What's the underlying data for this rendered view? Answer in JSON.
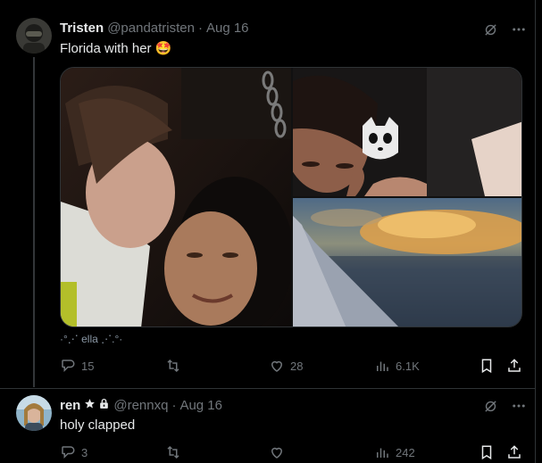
{
  "tweets": [
    {
      "display_name": "Tristen",
      "handle": "@pandatristen",
      "date": "Aug 16",
      "text": "Florida with her",
      "emoji": "🤩",
      "caption": "·°⋰ ella ⋰.°·",
      "stats": {
        "replies": "15",
        "retweets": "",
        "likes": "28",
        "views": "6.1K"
      }
    },
    {
      "display_name": "ren",
      "handle": "@rennxq",
      "date": "Aug 16",
      "text": "holy clapped",
      "stats": {
        "replies": "3",
        "retweets": "",
        "likes": "",
        "views": "242"
      }
    }
  ],
  "meta_sep": "·",
  "colors": {
    "bg": "#000000",
    "text": "#e7e9ea",
    "muted": "#71767b",
    "border": "#2f3336"
  },
  "icons": [
    "grok-icon",
    "more-icon",
    "reply-icon",
    "retweet-icon",
    "like-icon",
    "views-icon",
    "bookmark-icon",
    "share-icon",
    "star-icon",
    "lock-icon"
  ]
}
